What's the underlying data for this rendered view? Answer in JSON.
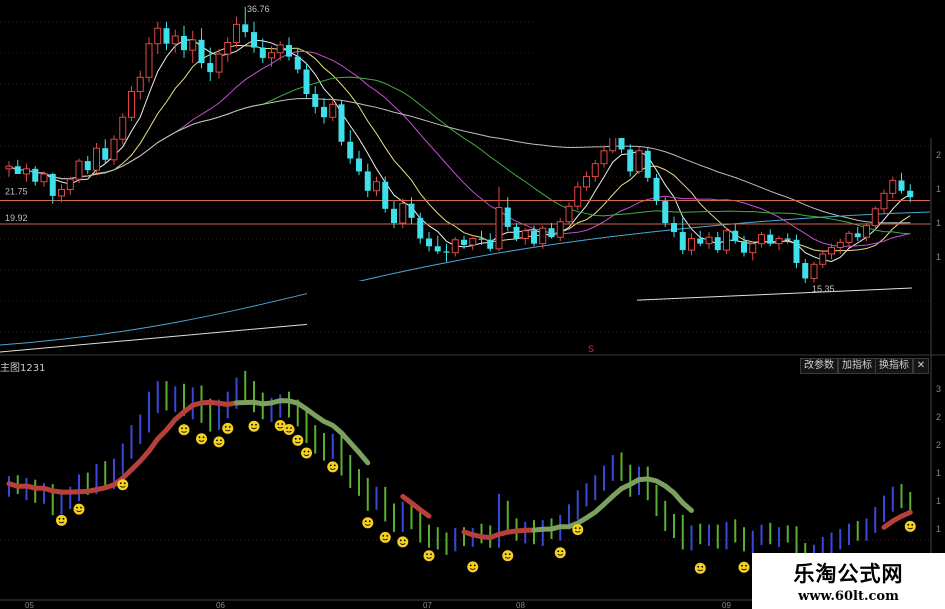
{
  "sub_chart": {
    "title": "主图1231",
    "buttons": {
      "change_params": "改参数",
      "add_indicator": "加指标",
      "switch_indicator": "换指标",
      "close": "✕"
    }
  },
  "main_chart": {
    "price_high_label": "36.76",
    "price_low_label": "15.35",
    "level_upper_label": "21.75",
    "level_lower_label": "19.92",
    "marker_label": "S",
    "right_axis_digits": [
      "2",
      "2",
      "2",
      "2",
      "2",
      "1",
      "1",
      "1"
    ],
    "sub_axis_digits": [
      "3",
      "2",
      "2",
      "1",
      "1",
      "1",
      "1",
      "1"
    ],
    "bottom_axis_digits": [
      "05",
      "06",
      "07",
      "08",
      "09",
      "1"
    ]
  },
  "watermark": {
    "name": "乐淘公式网",
    "url": "www.60lt.com"
  },
  "colors": {
    "up": "#e04848",
    "down": "#3fe0ea",
    "level": "#d0684a",
    "band_up": "#b8403a",
    "band_down": "#7ca060",
    "smiley": "#f4d020"
  },
  "chart_data": {
    "type": "candlestick",
    "candles": [
      [
        24.2,
        24.8,
        23.6,
        24.4
      ],
      [
        24.4,
        24.9,
        23.9,
        23.8
      ],
      [
        23.8,
        24.6,
        23.2,
        24.2
      ],
      [
        24.2,
        24.4,
        22.9,
        23.2
      ],
      [
        23.2,
        24.0,
        22.8,
        23.8
      ],
      [
        23.8,
        23.9,
        21.5,
        22.1
      ],
      [
        22.1,
        23.0,
        21.6,
        22.6
      ],
      [
        22.6,
        23.6,
        22.2,
        23.4
      ],
      [
        23.4,
        25.0,
        23.1,
        24.8
      ],
      [
        24.8,
        25.2,
        23.8,
        24.1
      ],
      [
        24.1,
        26.2,
        23.9,
        25.8
      ],
      [
        25.8,
        26.5,
        24.6,
        24.9
      ],
      [
        24.9,
        26.8,
        24.5,
        26.5
      ],
      [
        26.5,
        28.5,
        26.1,
        28.2
      ],
      [
        28.2,
        30.6,
        27.9,
        30.2
      ],
      [
        30.2,
        31.8,
        29.6,
        31.3
      ],
      [
        31.3,
        34.4,
        30.9,
        33.9
      ],
      [
        33.9,
        35.6,
        33.1,
        35.1
      ],
      [
        35.1,
        35.6,
        33.4,
        33.9
      ],
      [
        33.9,
        35.0,
        33.2,
        34.5
      ],
      [
        34.5,
        35.3,
        32.8,
        33.4
      ],
      [
        33.4,
        34.9,
        32.4,
        34.2
      ],
      [
        34.2,
        35.1,
        32.0,
        32.4
      ],
      [
        32.4,
        33.6,
        31.0,
        31.7
      ],
      [
        31.7,
        33.5,
        31.2,
        33.1
      ],
      [
        33.1,
        34.4,
        32.5,
        34.0
      ],
      [
        34.0,
        36.0,
        33.6,
        35.4
      ],
      [
        35.4,
        36.76,
        34.4,
        34.8
      ],
      [
        34.8,
        35.6,
        33.2,
        33.6
      ],
      [
        33.6,
        34.3,
        32.4,
        32.8
      ],
      [
        32.8,
        33.7,
        32.1,
        33.2
      ],
      [
        33.2,
        34.1,
        32.6,
        33.8
      ],
      [
        33.8,
        34.4,
        32.6,
        32.9
      ],
      [
        32.9,
        33.5,
        31.6,
        31.9
      ],
      [
        31.9,
        32.4,
        29.7,
        30.0
      ],
      [
        30.0,
        30.6,
        28.5,
        29.0
      ],
      [
        29.0,
        29.7,
        27.7,
        28.2
      ],
      [
        28.2,
        29.6,
        27.9,
        29.2
      ],
      [
        29.2,
        29.5,
        26.0,
        26.3
      ],
      [
        26.3,
        27.2,
        24.6,
        25.0
      ],
      [
        25.0,
        25.6,
        23.7,
        24.0
      ],
      [
        24.0,
        24.6,
        22.0,
        22.5
      ],
      [
        22.5,
        23.6,
        22.1,
        23.2
      ],
      [
        23.2,
        23.6,
        20.8,
        21.1
      ],
      [
        21.1,
        21.7,
        19.6,
        20.0
      ],
      [
        20.0,
        21.9,
        19.6,
        21.5
      ],
      [
        21.5,
        22.0,
        19.9,
        20.4
      ],
      [
        20.4,
        20.8,
        18.4,
        18.8
      ],
      [
        18.8,
        19.3,
        17.8,
        18.2
      ],
      [
        18.2,
        19.0,
        17.6,
        17.8
      ],
      [
        17.8,
        18.4,
        17.0,
        17.7
      ],
      [
        17.7,
        18.9,
        17.4,
        18.7
      ],
      [
        18.7,
        19.0,
        18.0,
        18.3
      ],
      [
        18.3,
        18.9,
        17.9,
        18.8
      ],
      [
        18.8,
        19.4,
        18.3,
        18.7
      ],
      [
        18.7,
        19.2,
        17.8,
        18.0
      ],
      [
        18.0,
        22.8,
        17.8,
        21.2
      ],
      [
        21.2,
        22.0,
        19.4,
        19.7
      ],
      [
        19.7,
        20.0,
        18.6,
        18.8
      ],
      [
        18.8,
        19.6,
        18.3,
        19.4
      ],
      [
        19.4,
        19.8,
        18.2,
        18.4
      ],
      [
        18.4,
        19.8,
        18.0,
        19.6
      ],
      [
        19.6,
        20.0,
        18.8,
        18.9
      ],
      [
        18.9,
        20.4,
        18.6,
        20.1
      ],
      [
        20.1,
        21.6,
        19.9,
        21.3
      ],
      [
        21.3,
        23.2,
        21.0,
        22.8
      ],
      [
        22.8,
        24.0,
        22.5,
        23.6
      ],
      [
        23.6,
        24.9,
        23.2,
        24.6
      ],
      [
        24.6,
        26.0,
        24.3,
        25.6
      ],
      [
        25.6,
        27.2,
        25.4,
        27.0
      ],
      [
        27.0,
        27.5,
        25.4,
        25.7
      ],
      [
        25.7,
        26.1,
        23.6,
        24.0
      ],
      [
        24.0,
        25.9,
        23.8,
        25.6
      ],
      [
        25.6,
        25.9,
        23.2,
        23.5
      ],
      [
        23.5,
        23.8,
        21.4,
        21.7
      ],
      [
        21.7,
        22.0,
        19.7,
        20.0
      ],
      [
        20.0,
        20.5,
        18.9,
        19.3
      ],
      [
        19.3,
        20.4,
        17.6,
        17.9
      ],
      [
        17.9,
        19.2,
        17.5,
        18.8
      ],
      [
        18.8,
        19.4,
        18.2,
        18.4
      ],
      [
        18.4,
        19.3,
        18.0,
        18.9
      ],
      [
        18.9,
        19.3,
        17.7,
        17.9
      ],
      [
        17.9,
        19.6,
        17.6,
        19.4
      ],
      [
        19.4,
        19.9,
        18.4,
        18.6
      ],
      [
        18.6,
        19.0,
        17.4,
        17.7
      ],
      [
        17.7,
        18.6,
        17.1,
        18.4
      ],
      [
        18.4,
        19.3,
        18.1,
        19.1
      ],
      [
        19.1,
        19.5,
        18.2,
        18.4
      ],
      [
        18.4,
        19.0,
        17.9,
        18.8
      ],
      [
        18.8,
        19.2,
        18.4,
        18.7
      ],
      [
        18.7,
        19.1,
        16.5,
        16.9
      ],
      [
        16.9,
        17.2,
        15.35,
        15.7
      ],
      [
        15.7,
        17.0,
        15.4,
        16.8
      ],
      [
        16.8,
        17.9,
        16.5,
        17.6
      ],
      [
        17.6,
        18.4,
        17.2,
        18.1
      ],
      [
        18.1,
        18.8,
        17.6,
        18.5
      ],
      [
        18.5,
        19.4,
        18.1,
        19.2
      ],
      [
        19.2,
        19.7,
        18.6,
        18.9
      ],
      [
        18.9,
        20.0,
        18.6,
        19.8
      ],
      [
        19.8,
        21.3,
        19.5,
        21.1
      ],
      [
        21.1,
        22.6,
        20.7,
        22.3
      ],
      [
        22.3,
        23.6,
        21.9,
        23.3
      ],
      [
        23.3,
        23.9,
        22.3,
        22.5
      ],
      [
        22.5,
        23.0,
        21.6,
        22.0
      ]
    ],
    "indicator": {
      "band_ranges": [
        [
          0,
          14,
          "up"
        ],
        [
          14,
          26,
          "up"
        ],
        [
          26,
          41,
          "down"
        ],
        [
          45,
          48,
          "up"
        ],
        [
          52,
          60,
          "up"
        ],
        [
          60,
          72,
          "down"
        ],
        [
          72,
          78,
          "down"
        ],
        [
          100,
          103,
          "up"
        ]
      ],
      "smileys": [
        [
          6,
          1
        ],
        [
          8,
          2
        ],
        [
          13,
          3
        ],
        [
          20,
          5
        ],
        [
          22,
          6
        ],
        [
          24,
          4
        ],
        [
          25,
          3
        ],
        [
          28,
          5
        ],
        [
          31,
          2
        ],
        [
          32,
          4
        ],
        [
          33,
          5
        ],
        [
          34,
          3
        ],
        [
          37,
          2
        ],
        [
          41,
          4
        ],
        [
          43,
          6
        ],
        [
          45,
          3
        ],
        [
          48,
          2
        ],
        [
          53,
          8
        ],
        [
          57,
          9
        ],
        [
          63,
          4
        ],
        [
          65,
          3
        ],
        [
          79,
          10
        ],
        [
          84,
          6
        ],
        [
          90,
          12
        ],
        [
          96,
          11
        ],
        [
          103,
          4
        ]
      ]
    }
  }
}
